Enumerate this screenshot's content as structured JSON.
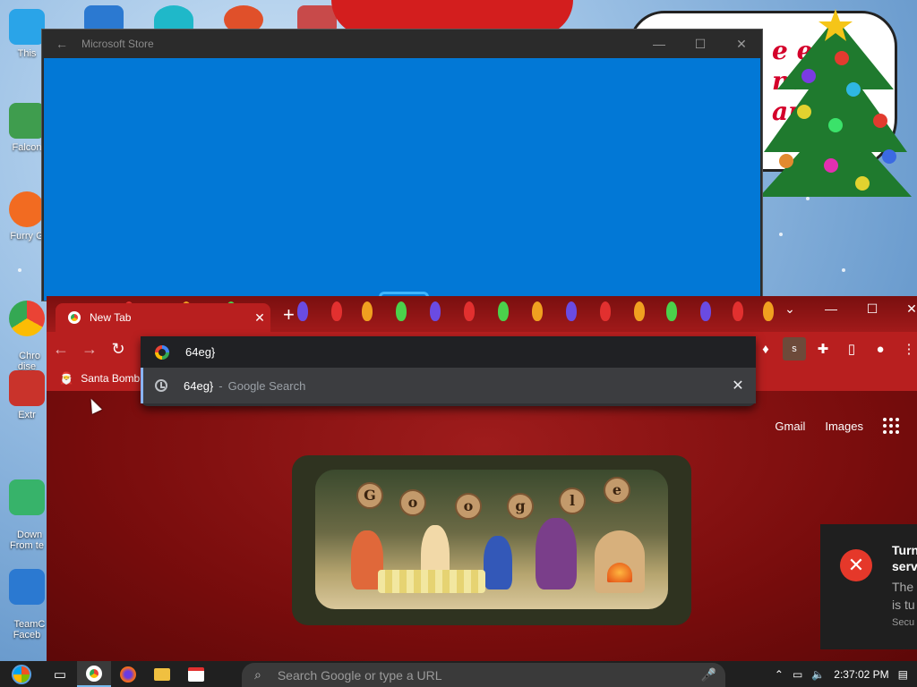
{
  "desktop": {
    "icons": [
      {
        "label": "This",
        "icon": "computer-icon"
      },
      {
        "label": "Falcon",
        "icon": "recycle-icon"
      },
      {
        "label": "Furry G",
        "icon": "firefox-icon"
      },
      {
        "label": "Chro\ndise",
        "icon": "chrome-icon"
      },
      {
        "label": "Extr",
        "icon": "archive-icon"
      },
      {
        "label": "Down\nFrom te",
        "icon": "download-icon"
      },
      {
        "label": "TeamC\nFaceb",
        "icon": "gear-icon"
      }
    ],
    "bubble_text": "e eat\nnd\nan"
  },
  "store_window": {
    "title": "Microsoft Store",
    "back": "←",
    "minimize": "—",
    "maximize": "☐",
    "close": "✕"
  },
  "chrome": {
    "tab": {
      "title": "New Tab",
      "close": "✕"
    },
    "new_tab": "+",
    "tab_search": "⌄",
    "window_controls": {
      "minimize": "—",
      "maximize": "☐",
      "close": "✕"
    },
    "nav": {
      "back": "←",
      "forward": "→",
      "reload": "↻"
    },
    "extensions": [
      "♦",
      "s",
      "✚",
      "▯",
      "●",
      "⋮"
    ],
    "bookmark": {
      "label": "Santa Bomb",
      "icon": "santa-icon"
    },
    "page": {
      "links": {
        "gmail": "Gmail",
        "images": "Images"
      },
      "doodle_letters": [
        "G",
        "o",
        "o",
        "g",
        "l",
        "e"
      ]
    }
  },
  "omnibox": {
    "input_value": "64eg}",
    "suggestion": {
      "query": "64eg}",
      "separator": "-",
      "description": "Google Search",
      "remove": "✕"
    }
  },
  "toast": {
    "title": "Turn\nserv",
    "body": "The\nis tu",
    "source": "Secu",
    "icon": "error-icon"
  },
  "taskbar": {
    "search_placeholder": "Search Google or type a URL",
    "time": "2:37:02 PM",
    "icons": [
      "task-view-icon",
      "chrome-icon",
      "firefox-icon",
      "folder-icon",
      "store-icon"
    ]
  },
  "colors": {
    "store_blue": "#0278d6",
    "chrome_red": "#b81f1f",
    "omnibox_dark": "#303134",
    "toast_error": "#e5382a"
  }
}
